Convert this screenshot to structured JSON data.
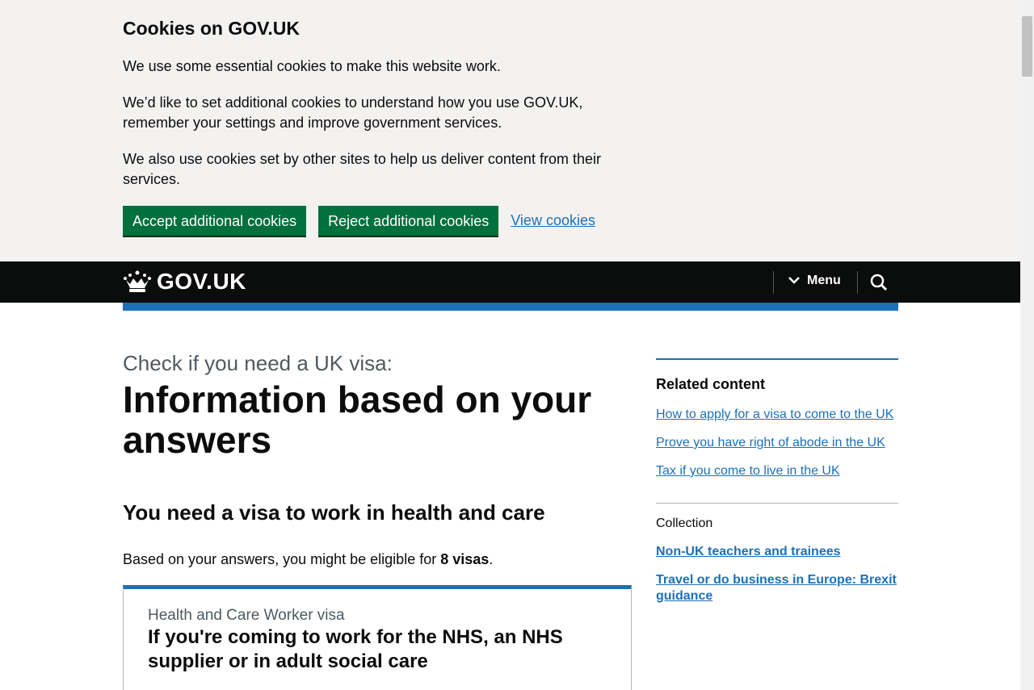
{
  "cookie_banner": {
    "title": "Cookies on GOV.UK",
    "p1": "We use some essential cookies to make this website work.",
    "p2": "We’d like to set additional cookies to understand how you use GOV.UK, remember your settings and improve government services.",
    "p3": "We also use cookies set by other sites to help us deliver content from their services.",
    "accept_label": "Accept additional cookies",
    "reject_label": "Reject additional cookies",
    "view_label": "View cookies"
  },
  "header": {
    "logo_text": "GOV.UK",
    "menu_label": "Menu"
  },
  "main": {
    "caption": "Check if you need a UK visa:",
    "title": "Information based on your answers",
    "subtitle": "You need a visa to work in health and care",
    "eligible_prefix": "Based on your answers, you might be eligible for ",
    "eligible_count": "8 visas",
    "eligible_suffix": ".",
    "card": {
      "caption": "Health and Care Worker visa",
      "title": "If you're coming to work for the NHS, an NHS supplier or in adult social care"
    }
  },
  "sidebar": {
    "related_title": "Related content",
    "related_links": [
      "How to apply for a visa to come to the UK",
      "Prove you have right of abode in the UK",
      "Tax if you come to live in the UK"
    ],
    "collection_label": "Collection",
    "collection_links": [
      "Non-UK teachers and trainees",
      "Travel or do business in Europe: Brexit guidance"
    ]
  },
  "colors": {
    "brand_blue": "#1d70b8",
    "button_green": "#00703c",
    "header_black": "#0b0c0c"
  }
}
